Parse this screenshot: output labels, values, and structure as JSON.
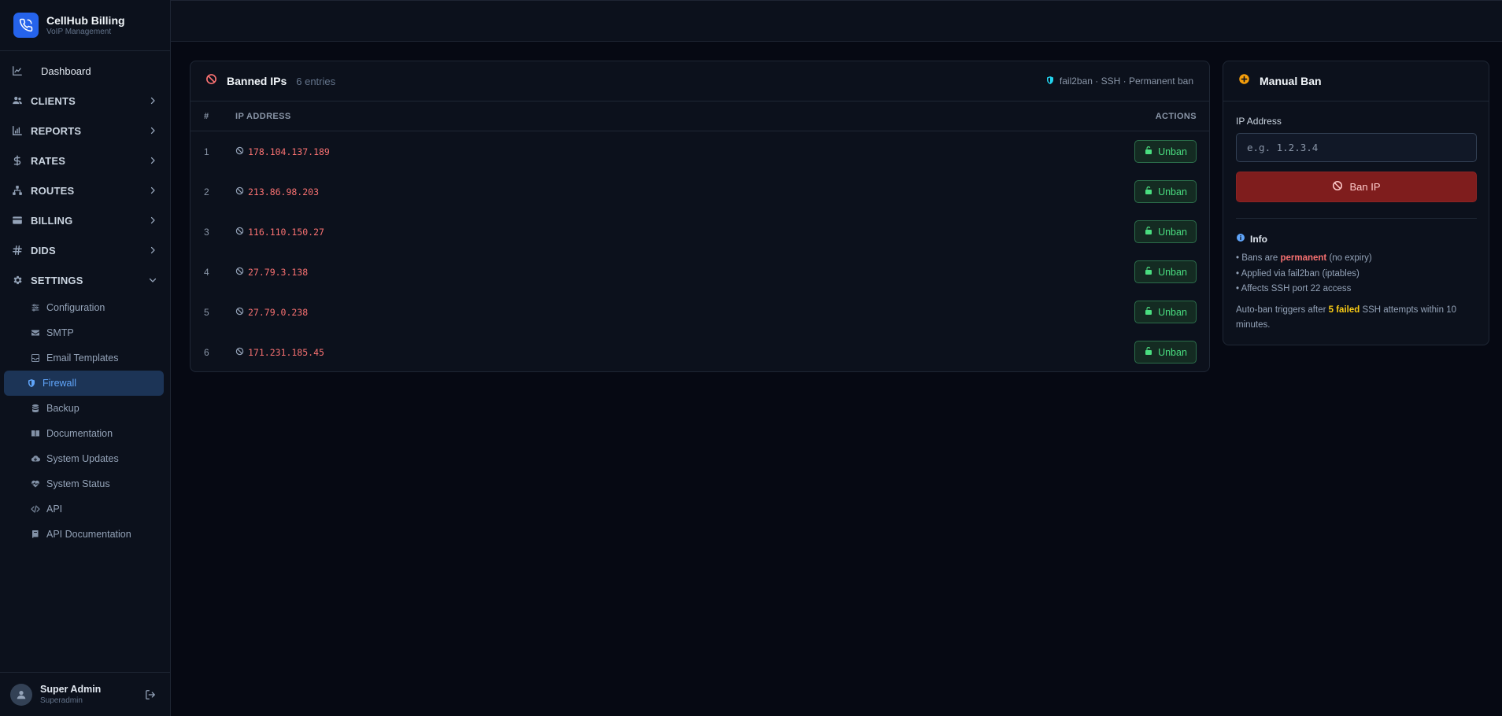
{
  "app": {
    "title": "CellHub Billing",
    "subtitle": "VoIP Management"
  },
  "sidebar": {
    "dashboard": "Dashboard",
    "groups": [
      "CLIENTS",
      "REPORTS",
      "RATES",
      "ROUTES",
      "BILLING",
      "DIDS",
      "SETTINGS"
    ],
    "settings_items": [
      "Configuration",
      "SMTP",
      "Email Templates",
      "Firewall",
      "Backup",
      "Documentation",
      "System Updates",
      "System Status",
      "API",
      "API Documentation"
    ],
    "active_item": "Firewall"
  },
  "user": {
    "name": "Super Admin",
    "role": "Superadmin"
  },
  "banned": {
    "title": "Banned IPs",
    "count": "6 entries",
    "meta": "fail2ban · SSH · Permanent ban",
    "columns": {
      "num": "#",
      "ip": "IP ADDRESS",
      "actions": "ACTIONS"
    },
    "rows": [
      {
        "num": "1",
        "ip": "178.104.137.189",
        "action": "Unban"
      },
      {
        "num": "2",
        "ip": "213.86.98.203",
        "action": "Unban"
      },
      {
        "num": "3",
        "ip": "116.110.150.27",
        "action": "Unban"
      },
      {
        "num": "4",
        "ip": "27.79.3.138",
        "action": "Unban"
      },
      {
        "num": "5",
        "ip": "27.79.0.238",
        "action": "Unban"
      },
      {
        "num": "6",
        "ip": "171.231.185.45",
        "action": "Unban"
      }
    ]
  },
  "manual": {
    "title": "Manual Ban",
    "field_label": "IP Address",
    "placeholder": "e.g. 1.2.3.4",
    "button": "Ban IP",
    "info_title": "Info",
    "bullet1": {
      "pre": "• Bans are ",
      "strong": "permanent",
      "post": " (no expiry)"
    },
    "bullet2": "• Applied via fail2ban (iptables)",
    "bullet3": "• Affects SSH port 22 access",
    "autoban": {
      "pre": "Auto-ban triggers after ",
      "strong": "5 failed",
      "post": " SSH attempts within 10 minutes."
    }
  },
  "colors": {
    "accent": "#2563eb",
    "danger": "#f87171",
    "success": "#4ade80",
    "warning": "#facc15",
    "active_bg": "#1c3456"
  }
}
